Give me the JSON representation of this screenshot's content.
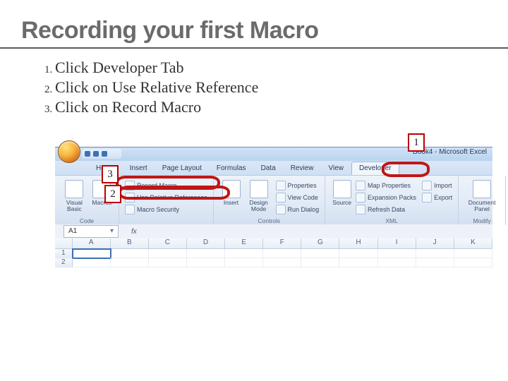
{
  "slide": {
    "title": "Recording your first Macro",
    "steps": [
      "Click Developer Tab",
      "Click on Use Relative Reference",
      "Click on Record Macro"
    ]
  },
  "app": {
    "window_title": "Book4 - Microsoft Excel",
    "tabs": [
      "Home",
      "Insert",
      "Page Layout",
      "Formulas",
      "Data",
      "Review",
      "View",
      "Developer"
    ],
    "active_tab": "Developer",
    "name_box": "A1",
    "columns": [
      "A",
      "B",
      "C",
      "D",
      "E",
      "F",
      "G",
      "H",
      "I",
      "J",
      "K"
    ],
    "rows": [
      "1",
      "2"
    ]
  },
  "ribbon": {
    "code": {
      "visual_basic": "Visual\nBasic",
      "macros": "Macros",
      "record_macro": "Record Macro",
      "use_relative": "Use Relative References",
      "macro_security": "Macro Security",
      "group": "Code"
    },
    "controls": {
      "insert": "Insert",
      "design_mode": "Design\nMode",
      "properties": "Properties",
      "view_code": "View Code",
      "run_dialog": "Run Dialog",
      "group": "Controls"
    },
    "xml": {
      "source": "Source",
      "map_properties": "Map Properties",
      "expansion_packs": "Expansion Packs",
      "refresh_data": "Refresh Data",
      "import": "Import",
      "export": "Export",
      "group": "XML"
    },
    "modify": {
      "document_panel": "Document\nPanel",
      "group": "Modify"
    }
  },
  "callouts": {
    "c1": "1",
    "c2": "2",
    "c3": "3"
  }
}
